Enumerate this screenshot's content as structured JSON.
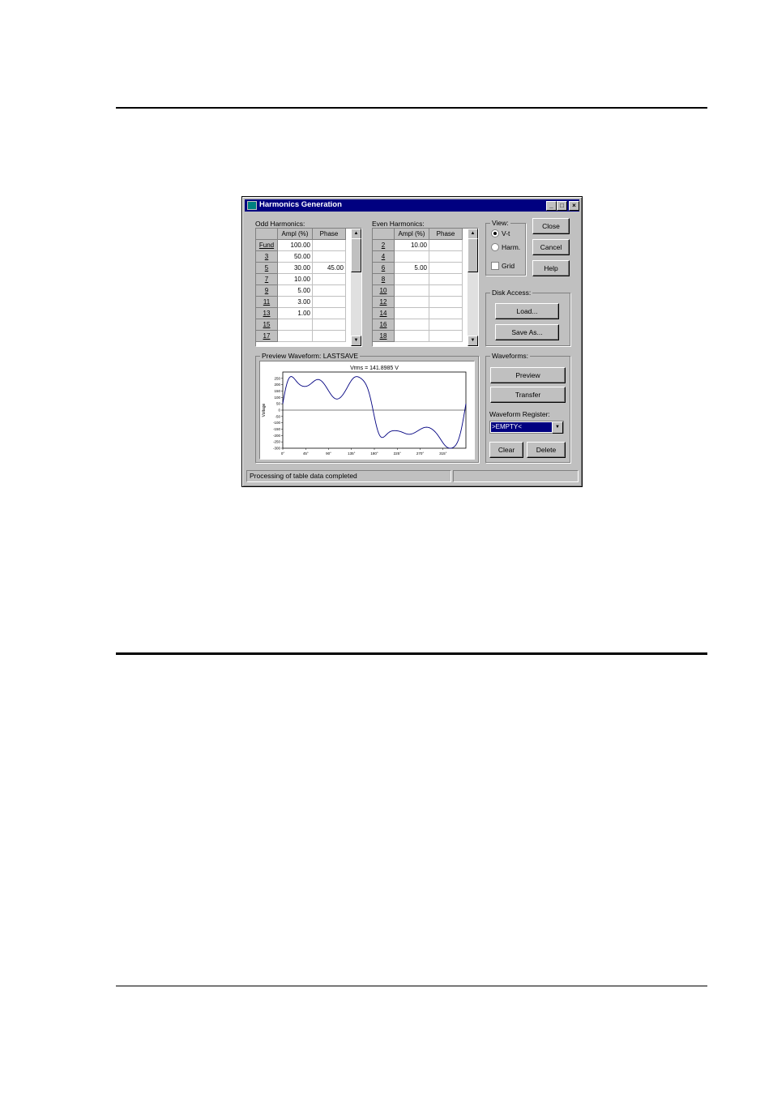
{
  "window": {
    "title": "Harmonics Generation"
  },
  "title_buttons": {
    "minimize": "_",
    "maximize": "□",
    "close": "×"
  },
  "odd": {
    "label": "Odd Harmonics:",
    "headers": [
      "",
      "Ampl (%)",
      "Phase"
    ],
    "rows": [
      [
        "Fund",
        "100.00",
        ""
      ],
      [
        "3",
        "50.00",
        ""
      ],
      [
        "5",
        "30.00",
        "45.00"
      ],
      [
        "7",
        "10.00",
        ""
      ],
      [
        "9",
        "5.00",
        ""
      ],
      [
        "11",
        "3.00",
        ""
      ],
      [
        "13",
        "1.00",
        ""
      ],
      [
        "15",
        "",
        ""
      ],
      [
        "17",
        "",
        ""
      ]
    ]
  },
  "even": {
    "label": "Even Harmonics:",
    "headers": [
      "",
      "Ampl (%)",
      "Phase"
    ],
    "rows": [
      [
        "2",
        "10.00",
        ""
      ],
      [
        "4",
        "",
        ""
      ],
      [
        "6",
        "5.00",
        ""
      ],
      [
        "8",
        "",
        ""
      ],
      [
        "10",
        "",
        ""
      ],
      [
        "12",
        "",
        ""
      ],
      [
        "14",
        "",
        ""
      ],
      [
        "16",
        "",
        ""
      ],
      [
        "18",
        "",
        ""
      ]
    ]
  },
  "view": {
    "label": "View:",
    "vt": "V-t",
    "harm": "Harm.",
    "grid": "Grid",
    "selected": "V-t"
  },
  "buttons": {
    "close": "Close",
    "cancel": "Cancel",
    "help": "Help",
    "load": "Load...",
    "save_as": "Save As...",
    "preview": "Preview",
    "transfer": "Transfer",
    "clear": "Clear",
    "delete": "Delete"
  },
  "disk_access": {
    "label": "Disk Access:"
  },
  "waveforms": {
    "label": "Waveforms:",
    "register_label": "Waveform Register:",
    "register_value": ">EMPTY<"
  },
  "preview": {
    "label": "Preview Waveform: LASTSAVE"
  },
  "status": {
    "text": "Processing of table data completed"
  },
  "chart_data": {
    "type": "line",
    "title": "Vrms = 141.8985 V",
    "xlabel": "",
    "ylabel": "Voltage",
    "xlim": [
      0,
      360
    ],
    "ylim": [
      -300,
      300
    ],
    "x_ticks": [
      "0°",
      "45°",
      "90°",
      "135°",
      "180°",
      "225°",
      "270°",
      "315°"
    ],
    "y_ticks": [
      "250",
      "200",
      "150",
      "100",
      "50",
      "0",
      "-50",
      "-100",
      "-150",
      "-200",
      "-250",
      "-300"
    ],
    "grid": false,
    "series": [
      {
        "color": "#000080",
        "harmonics": [
          {
            "n": 1,
            "amp": 100,
            "phase": 0
          },
          {
            "n": 2,
            "amp": 10,
            "phase": 0
          },
          {
            "n": 3,
            "amp": 50,
            "phase": 0
          },
          {
            "n": 5,
            "amp": 30,
            "phase": 45
          },
          {
            "n": 6,
            "amp": 5,
            "phase": 0
          },
          {
            "n": 7,
            "amp": 10,
            "phase": 0
          },
          {
            "n": 9,
            "amp": 5,
            "phase": 0
          },
          {
            "n": 11,
            "amp": 3,
            "phase": 0
          },
          {
            "n": 13,
            "amp": 1,
            "phase": 0
          }
        ],
        "peak": 300
      }
    ]
  }
}
